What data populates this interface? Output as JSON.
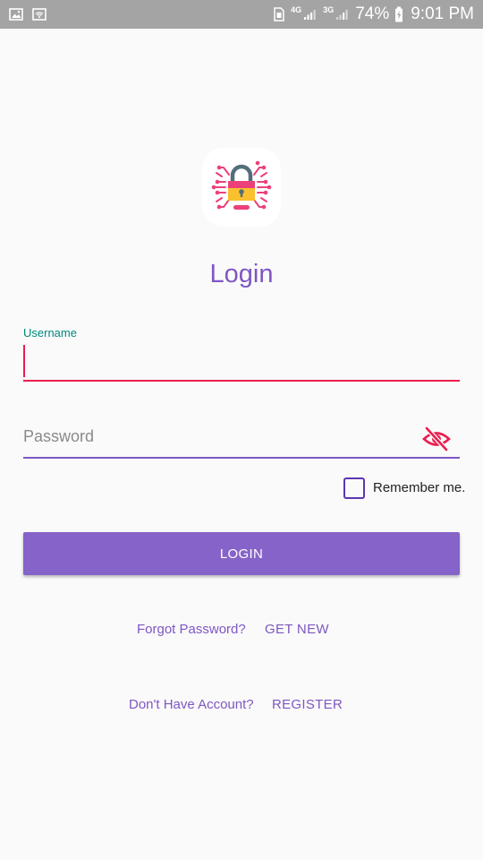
{
  "status_bar": {
    "network_4g": "4G",
    "network_3g": "3G",
    "battery": "74%",
    "time": "9:01 PM"
  },
  "login": {
    "title": "Login",
    "username": {
      "label": "Username",
      "value": ""
    },
    "password": {
      "placeholder": "Password",
      "value": ""
    },
    "remember": {
      "label": "Remember me.",
      "checked": false
    },
    "submit_label": "LOGIN",
    "forgot": {
      "prompt": "Forgot Password?",
      "action": "GET NEW"
    },
    "register": {
      "prompt": "Don't Have Account?",
      "action": "REGISTER"
    }
  },
  "colors": {
    "accent": "#7e57c2",
    "button": "#8663c9",
    "error": "#e91e4f",
    "label": "#00897b"
  },
  "icons": {
    "app": "circuit-padlock-icon",
    "password_toggle": "eye-off-icon"
  }
}
